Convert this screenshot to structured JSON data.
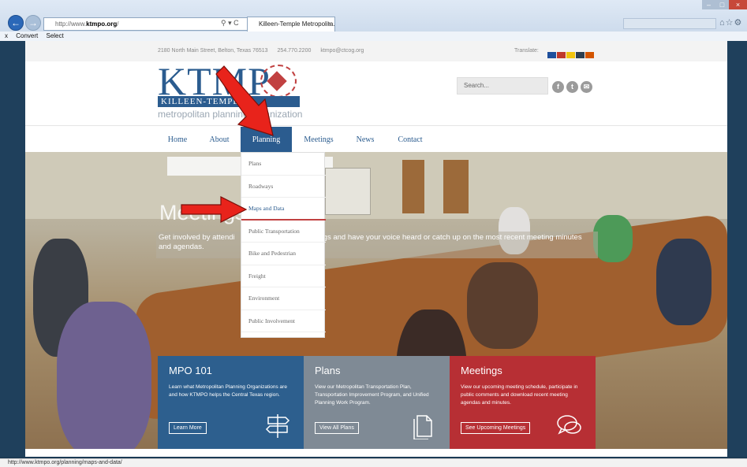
{
  "browser": {
    "address": "http://www.ktmpo.org/",
    "address_prefix": "http://www.",
    "address_domain": "ktmpo.org",
    "address_suffix": "/",
    "address_icons": "⚲ ▾ C",
    "tab_title": "Killeen-Temple Metropolita...",
    "tab_close": "×",
    "search_placeholder": "",
    "toolbar": {
      "close": "x",
      "convert": "Convert",
      "select": "Select"
    },
    "status_url": "http://www.ktmpo.org/planning/maps-and-data/"
  },
  "topbar": {
    "address": "2180 North Main Street, Belton, Texas 76513",
    "phone": "254.770.2200",
    "email": "ktmpo@ctcog.org",
    "translate_label": "Translate:",
    "flags": [
      "#1e4f9c",
      "#c0392b",
      "#f1c40f",
      "#2c3e50",
      "#d35400"
    ]
  },
  "logo": {
    "letters": "KTMP",
    "bar_text": "KILLEEN-TEMPLE",
    "subtitle": "metropolitan planning organization"
  },
  "header": {
    "search_placeholder": "Search...",
    "social": [
      "f",
      "t",
      "✉"
    ]
  },
  "nav": [
    "Home",
    "About",
    "Planning",
    "Meetings",
    "News",
    "Contact"
  ],
  "dropdown": [
    "Plans",
    "Roadways",
    "Maps and Data",
    "Public Transportation",
    "Bike and Pedestrian",
    "Freight",
    "Environment",
    "Public Involvement"
  ],
  "hero": {
    "title": "Meetings",
    "desc_left": "Get involved by attendi",
    "desc_right": "gs and have your voice heard or catch up on the most recent meeting minutes",
    "desc_line2": "and agendas."
  },
  "cards": [
    {
      "title": "MPO 101",
      "body": "Learn what Metropolitan Planning Organizations are and how KTMPO helps the Central Texas region.",
      "button": "Learn More",
      "color": "#2d5f8e",
      "icon": "signpost-icon"
    },
    {
      "title": "Plans",
      "body": "View our Metropolitan Transportation Plan, Transportation Improvement Program, and Unified Planning Work Program.",
      "button": "View All Plans",
      "color": "#7f8a95",
      "icon": "document-icon"
    },
    {
      "title": "Meetings",
      "body": "View our upcoming meeting schedule, participate in public comments and download recent meeting agendas and minutes.",
      "button": "See Upcoming Meetings",
      "color": "#b72f34",
      "icon": "chat-bubbles-icon"
    }
  ],
  "colors": {
    "brand_blue": "#2b5c8f",
    "accent_red": "#c14141",
    "arrow_red": "#e8231b"
  }
}
